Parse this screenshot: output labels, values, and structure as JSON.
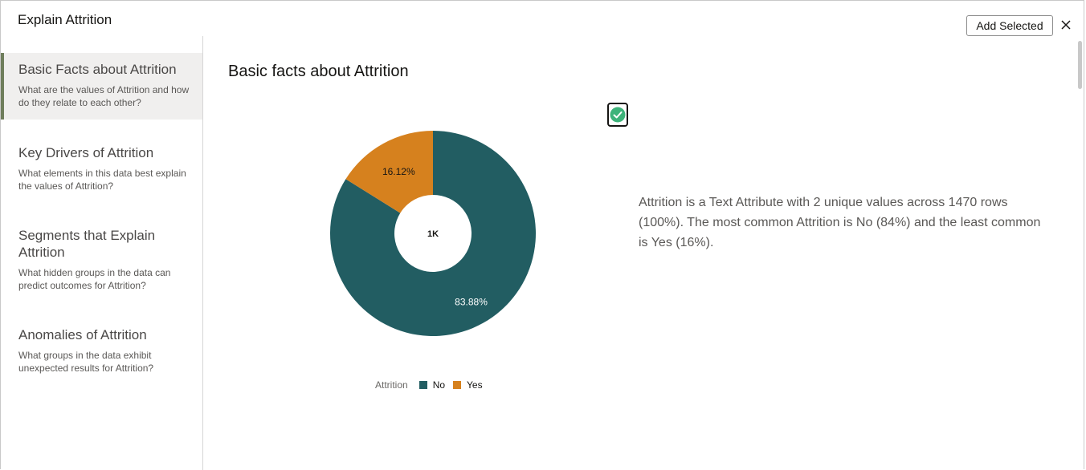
{
  "dialog": {
    "title": "Explain Attrition",
    "add_selected_label": "Add Selected",
    "close_label": "×"
  },
  "sidebar": {
    "items": [
      {
        "title": "Basic Facts about Attrition",
        "desc": "What are the values of Attrition and how do they relate to each other?",
        "active": true
      },
      {
        "title": "Key Drivers of Attrition",
        "desc": "What elements in this data best explain the values of Attrition?",
        "active": false
      },
      {
        "title": "Segments that Explain Attrition",
        "desc": "What hidden groups in the data can predict outcomes for Attrition?",
        "active": false
      },
      {
        "title": "Anomalies of Attrition",
        "desc": "What groups in the data exhibit unexpected results for Attrition?",
        "active": false
      }
    ]
  },
  "main": {
    "section_title": "Basic facts about Attrition",
    "selected": true,
    "summary": "Attrition is a Text Attribute with 2 unique values across 1470 rows (100%). The most common Attrition is No (84%) and the least common is Yes (16%)."
  },
  "colors": {
    "no": "#225d62",
    "yes": "#d6811e",
    "check": "#3db37a",
    "active_marker": "#6f7e5c"
  },
  "chart_data": {
    "type": "pie",
    "donut": true,
    "center_label": "1K",
    "legend_title": "Attrition",
    "slices": [
      {
        "name": "No",
        "value": 83.88,
        "label": "83.88%"
      },
      {
        "name": "Yes",
        "value": 16.12,
        "label": "16.12%"
      }
    ]
  }
}
